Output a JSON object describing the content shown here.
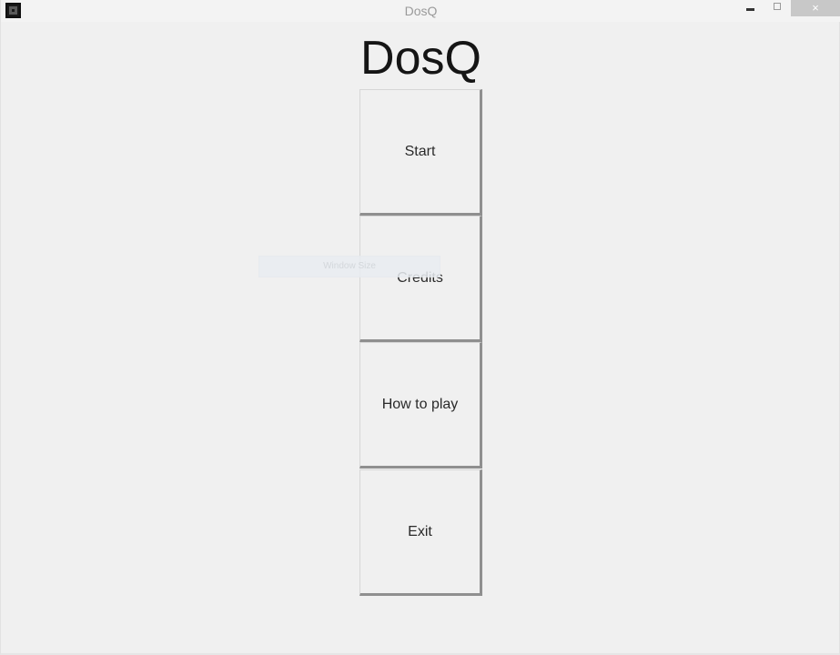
{
  "window": {
    "title": "DosQ",
    "close_glyph": "×",
    "icons": [
      "app-icon",
      "minimize-icon",
      "maximize-icon",
      "close-icon"
    ]
  },
  "main": {
    "heading": "DosQ",
    "buttons": [
      {
        "label": "Start"
      },
      {
        "label": "Credits"
      },
      {
        "label": "How to play"
      },
      {
        "label": "Exit"
      }
    ]
  },
  "tooltip": {
    "text": "Window Size"
  },
  "colors": {
    "background": "#f0f0f0",
    "close_button": "#c8c8c8",
    "text": "#151515"
  }
}
